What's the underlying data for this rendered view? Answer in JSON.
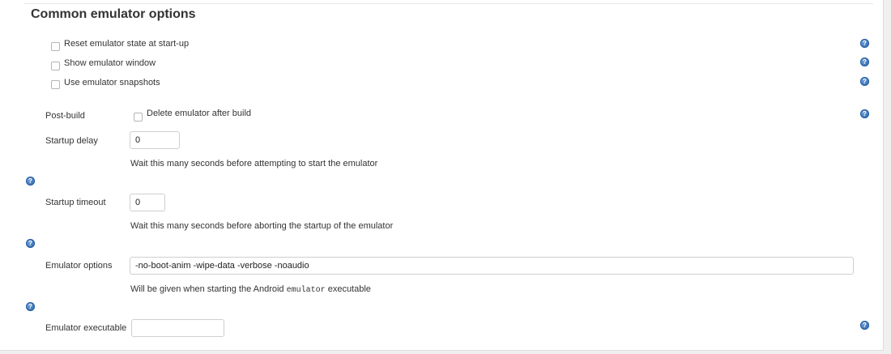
{
  "section": {
    "title": "Common emulator options"
  },
  "checkboxes": [
    {
      "label": "Reset emulator state at start-up",
      "checked": false
    },
    {
      "label": "Show emulator window",
      "checked": false
    },
    {
      "label": "Use emulator snapshots",
      "checked": false
    }
  ],
  "post_build": {
    "label": "Post-build",
    "checkbox_label": "Delete emulator after build",
    "checked": false
  },
  "startup_delay": {
    "label": "Startup delay",
    "value": "0",
    "description": "Wait this many seconds before attempting to start the emulator"
  },
  "startup_timeout": {
    "label": "Startup timeout",
    "value": "0",
    "description": "Wait this many seconds before aborting the startup of the emulator"
  },
  "emulator_options": {
    "label": "Emulator options",
    "value": "-no-boot-anim -wipe-data -verbose -noaudio",
    "description_prefix": "Will be given when starting the Android",
    "description_code": "emulator",
    "description_suffix": "executable"
  },
  "emulator_executable": {
    "label": "Emulator executable",
    "value": ""
  },
  "help_icon_glyph": "?",
  "colors": {
    "help_icon": "#1f5fa8",
    "background": "#f0f0f0",
    "panel": "#ffffff"
  }
}
